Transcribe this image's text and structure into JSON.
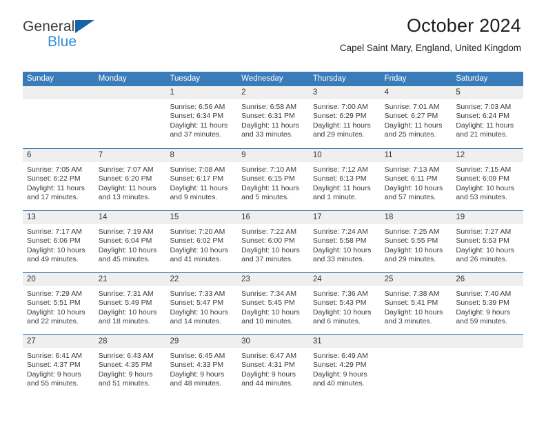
{
  "brand": {
    "line1": "General",
    "line2": "Blue",
    "mark": "triangle-logo-icon"
  },
  "header": {
    "title": "October 2024",
    "subtitle": "Capel Saint Mary, England, United Kingdom"
  },
  "colors": {
    "header_blue": "#3a7cba",
    "row_divider_blue": "#2b6cad",
    "day_band_gray": "#efefef",
    "brand_blue": "#2a8fe0",
    "brand_mark_blue": "#1763a6"
  },
  "weekdays": [
    "Sunday",
    "Monday",
    "Tuesday",
    "Wednesday",
    "Thursday",
    "Friday",
    "Saturday"
  ],
  "weeks": [
    [
      {
        "day": ""
      },
      {
        "day": ""
      },
      {
        "day": "1",
        "sunrise": "Sunrise: 6:56 AM",
        "sunset": "Sunset: 6:34 PM",
        "daylight": "Daylight: 11 hours and 37 minutes."
      },
      {
        "day": "2",
        "sunrise": "Sunrise: 6:58 AM",
        "sunset": "Sunset: 6:31 PM",
        "daylight": "Daylight: 11 hours and 33 minutes."
      },
      {
        "day": "3",
        "sunrise": "Sunrise: 7:00 AM",
        "sunset": "Sunset: 6:29 PM",
        "daylight": "Daylight: 11 hours and 29 minutes."
      },
      {
        "day": "4",
        "sunrise": "Sunrise: 7:01 AM",
        "sunset": "Sunset: 6:27 PM",
        "daylight": "Daylight: 11 hours and 25 minutes."
      },
      {
        "day": "5",
        "sunrise": "Sunrise: 7:03 AM",
        "sunset": "Sunset: 6:24 PM",
        "daylight": "Daylight: 11 hours and 21 minutes."
      }
    ],
    [
      {
        "day": "6",
        "sunrise": "Sunrise: 7:05 AM",
        "sunset": "Sunset: 6:22 PM",
        "daylight": "Daylight: 11 hours and 17 minutes."
      },
      {
        "day": "7",
        "sunrise": "Sunrise: 7:07 AM",
        "sunset": "Sunset: 6:20 PM",
        "daylight": "Daylight: 11 hours and 13 minutes."
      },
      {
        "day": "8",
        "sunrise": "Sunrise: 7:08 AM",
        "sunset": "Sunset: 6:17 PM",
        "daylight": "Daylight: 11 hours and 9 minutes."
      },
      {
        "day": "9",
        "sunrise": "Sunrise: 7:10 AM",
        "sunset": "Sunset: 6:15 PM",
        "daylight": "Daylight: 11 hours and 5 minutes."
      },
      {
        "day": "10",
        "sunrise": "Sunrise: 7:12 AM",
        "sunset": "Sunset: 6:13 PM",
        "daylight": "Daylight: 11 hours and 1 minute."
      },
      {
        "day": "11",
        "sunrise": "Sunrise: 7:13 AM",
        "sunset": "Sunset: 6:11 PM",
        "daylight": "Daylight: 10 hours and 57 minutes."
      },
      {
        "day": "12",
        "sunrise": "Sunrise: 7:15 AM",
        "sunset": "Sunset: 6:09 PM",
        "daylight": "Daylight: 10 hours and 53 minutes."
      }
    ],
    [
      {
        "day": "13",
        "sunrise": "Sunrise: 7:17 AM",
        "sunset": "Sunset: 6:06 PM",
        "daylight": "Daylight: 10 hours and 49 minutes."
      },
      {
        "day": "14",
        "sunrise": "Sunrise: 7:19 AM",
        "sunset": "Sunset: 6:04 PM",
        "daylight": "Daylight: 10 hours and 45 minutes."
      },
      {
        "day": "15",
        "sunrise": "Sunrise: 7:20 AM",
        "sunset": "Sunset: 6:02 PM",
        "daylight": "Daylight: 10 hours and 41 minutes."
      },
      {
        "day": "16",
        "sunrise": "Sunrise: 7:22 AM",
        "sunset": "Sunset: 6:00 PM",
        "daylight": "Daylight: 10 hours and 37 minutes."
      },
      {
        "day": "17",
        "sunrise": "Sunrise: 7:24 AM",
        "sunset": "Sunset: 5:58 PM",
        "daylight": "Daylight: 10 hours and 33 minutes."
      },
      {
        "day": "18",
        "sunrise": "Sunrise: 7:25 AM",
        "sunset": "Sunset: 5:55 PM",
        "daylight": "Daylight: 10 hours and 29 minutes."
      },
      {
        "day": "19",
        "sunrise": "Sunrise: 7:27 AM",
        "sunset": "Sunset: 5:53 PM",
        "daylight": "Daylight: 10 hours and 26 minutes."
      }
    ],
    [
      {
        "day": "20",
        "sunrise": "Sunrise: 7:29 AM",
        "sunset": "Sunset: 5:51 PM",
        "daylight": "Daylight: 10 hours and 22 minutes."
      },
      {
        "day": "21",
        "sunrise": "Sunrise: 7:31 AM",
        "sunset": "Sunset: 5:49 PM",
        "daylight": "Daylight: 10 hours and 18 minutes."
      },
      {
        "day": "22",
        "sunrise": "Sunrise: 7:33 AM",
        "sunset": "Sunset: 5:47 PM",
        "daylight": "Daylight: 10 hours and 14 minutes."
      },
      {
        "day": "23",
        "sunrise": "Sunrise: 7:34 AM",
        "sunset": "Sunset: 5:45 PM",
        "daylight": "Daylight: 10 hours and 10 minutes."
      },
      {
        "day": "24",
        "sunrise": "Sunrise: 7:36 AM",
        "sunset": "Sunset: 5:43 PM",
        "daylight": "Daylight: 10 hours and 6 minutes."
      },
      {
        "day": "25",
        "sunrise": "Sunrise: 7:38 AM",
        "sunset": "Sunset: 5:41 PM",
        "daylight": "Daylight: 10 hours and 3 minutes."
      },
      {
        "day": "26",
        "sunrise": "Sunrise: 7:40 AM",
        "sunset": "Sunset: 5:39 PM",
        "daylight": "Daylight: 9 hours and 59 minutes."
      }
    ],
    [
      {
        "day": "27",
        "sunrise": "Sunrise: 6:41 AM",
        "sunset": "Sunset: 4:37 PM",
        "daylight": "Daylight: 9 hours and 55 minutes."
      },
      {
        "day": "28",
        "sunrise": "Sunrise: 6:43 AM",
        "sunset": "Sunset: 4:35 PM",
        "daylight": "Daylight: 9 hours and 51 minutes."
      },
      {
        "day": "29",
        "sunrise": "Sunrise: 6:45 AM",
        "sunset": "Sunset: 4:33 PM",
        "daylight": "Daylight: 9 hours and 48 minutes."
      },
      {
        "day": "30",
        "sunrise": "Sunrise: 6:47 AM",
        "sunset": "Sunset: 4:31 PM",
        "daylight": "Daylight: 9 hours and 44 minutes."
      },
      {
        "day": "31",
        "sunrise": "Sunrise: 6:49 AM",
        "sunset": "Sunset: 4:29 PM",
        "daylight": "Daylight: 9 hours and 40 minutes."
      },
      {
        "day": ""
      },
      {
        "day": ""
      }
    ]
  ]
}
